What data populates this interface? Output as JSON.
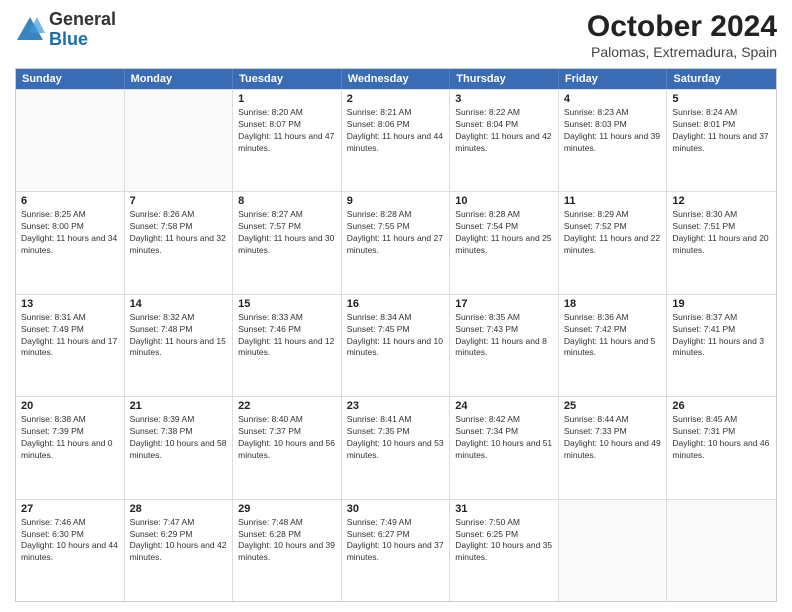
{
  "logo": {
    "general": "General",
    "blue": "Blue"
  },
  "header": {
    "title": "October 2024",
    "subtitle": "Palomas, Extremadura, Spain"
  },
  "weekdays": [
    "Sunday",
    "Monday",
    "Tuesday",
    "Wednesday",
    "Thursday",
    "Friday",
    "Saturday"
  ],
  "rows": [
    [
      {
        "day": "",
        "info": ""
      },
      {
        "day": "",
        "info": ""
      },
      {
        "day": "1",
        "info": "Sunrise: 8:20 AM\nSunset: 8:07 PM\nDaylight: 11 hours and 47 minutes."
      },
      {
        "day": "2",
        "info": "Sunrise: 8:21 AM\nSunset: 8:06 PM\nDaylight: 11 hours and 44 minutes."
      },
      {
        "day": "3",
        "info": "Sunrise: 8:22 AM\nSunset: 8:04 PM\nDaylight: 11 hours and 42 minutes."
      },
      {
        "day": "4",
        "info": "Sunrise: 8:23 AM\nSunset: 8:03 PM\nDaylight: 11 hours and 39 minutes."
      },
      {
        "day": "5",
        "info": "Sunrise: 8:24 AM\nSunset: 8:01 PM\nDaylight: 11 hours and 37 minutes."
      }
    ],
    [
      {
        "day": "6",
        "info": "Sunrise: 8:25 AM\nSunset: 8:00 PM\nDaylight: 11 hours and 34 minutes."
      },
      {
        "day": "7",
        "info": "Sunrise: 8:26 AM\nSunset: 7:58 PM\nDaylight: 11 hours and 32 minutes."
      },
      {
        "day": "8",
        "info": "Sunrise: 8:27 AM\nSunset: 7:57 PM\nDaylight: 11 hours and 30 minutes."
      },
      {
        "day": "9",
        "info": "Sunrise: 8:28 AM\nSunset: 7:55 PM\nDaylight: 11 hours and 27 minutes."
      },
      {
        "day": "10",
        "info": "Sunrise: 8:28 AM\nSunset: 7:54 PM\nDaylight: 11 hours and 25 minutes."
      },
      {
        "day": "11",
        "info": "Sunrise: 8:29 AM\nSunset: 7:52 PM\nDaylight: 11 hours and 22 minutes."
      },
      {
        "day": "12",
        "info": "Sunrise: 8:30 AM\nSunset: 7:51 PM\nDaylight: 11 hours and 20 minutes."
      }
    ],
    [
      {
        "day": "13",
        "info": "Sunrise: 8:31 AM\nSunset: 7:49 PM\nDaylight: 11 hours and 17 minutes."
      },
      {
        "day": "14",
        "info": "Sunrise: 8:32 AM\nSunset: 7:48 PM\nDaylight: 11 hours and 15 minutes."
      },
      {
        "day": "15",
        "info": "Sunrise: 8:33 AM\nSunset: 7:46 PM\nDaylight: 11 hours and 12 minutes."
      },
      {
        "day": "16",
        "info": "Sunrise: 8:34 AM\nSunset: 7:45 PM\nDaylight: 11 hours and 10 minutes."
      },
      {
        "day": "17",
        "info": "Sunrise: 8:35 AM\nSunset: 7:43 PM\nDaylight: 11 hours and 8 minutes."
      },
      {
        "day": "18",
        "info": "Sunrise: 8:36 AM\nSunset: 7:42 PM\nDaylight: 11 hours and 5 minutes."
      },
      {
        "day": "19",
        "info": "Sunrise: 8:37 AM\nSunset: 7:41 PM\nDaylight: 11 hours and 3 minutes."
      }
    ],
    [
      {
        "day": "20",
        "info": "Sunrise: 8:38 AM\nSunset: 7:39 PM\nDaylight: 11 hours and 0 minutes."
      },
      {
        "day": "21",
        "info": "Sunrise: 8:39 AM\nSunset: 7:38 PM\nDaylight: 10 hours and 58 minutes."
      },
      {
        "day": "22",
        "info": "Sunrise: 8:40 AM\nSunset: 7:37 PM\nDaylight: 10 hours and 56 minutes."
      },
      {
        "day": "23",
        "info": "Sunrise: 8:41 AM\nSunset: 7:35 PM\nDaylight: 10 hours and 53 minutes."
      },
      {
        "day": "24",
        "info": "Sunrise: 8:42 AM\nSunset: 7:34 PM\nDaylight: 10 hours and 51 minutes."
      },
      {
        "day": "25",
        "info": "Sunrise: 8:44 AM\nSunset: 7:33 PM\nDaylight: 10 hours and 49 minutes."
      },
      {
        "day": "26",
        "info": "Sunrise: 8:45 AM\nSunset: 7:31 PM\nDaylight: 10 hours and 46 minutes."
      }
    ],
    [
      {
        "day": "27",
        "info": "Sunrise: 7:46 AM\nSunset: 6:30 PM\nDaylight: 10 hours and 44 minutes."
      },
      {
        "day": "28",
        "info": "Sunrise: 7:47 AM\nSunset: 6:29 PM\nDaylight: 10 hours and 42 minutes."
      },
      {
        "day": "29",
        "info": "Sunrise: 7:48 AM\nSunset: 6:28 PM\nDaylight: 10 hours and 39 minutes."
      },
      {
        "day": "30",
        "info": "Sunrise: 7:49 AM\nSunset: 6:27 PM\nDaylight: 10 hours and 37 minutes."
      },
      {
        "day": "31",
        "info": "Sunrise: 7:50 AM\nSunset: 6:25 PM\nDaylight: 10 hours and 35 minutes."
      },
      {
        "day": "",
        "info": ""
      },
      {
        "day": "",
        "info": ""
      }
    ]
  ]
}
